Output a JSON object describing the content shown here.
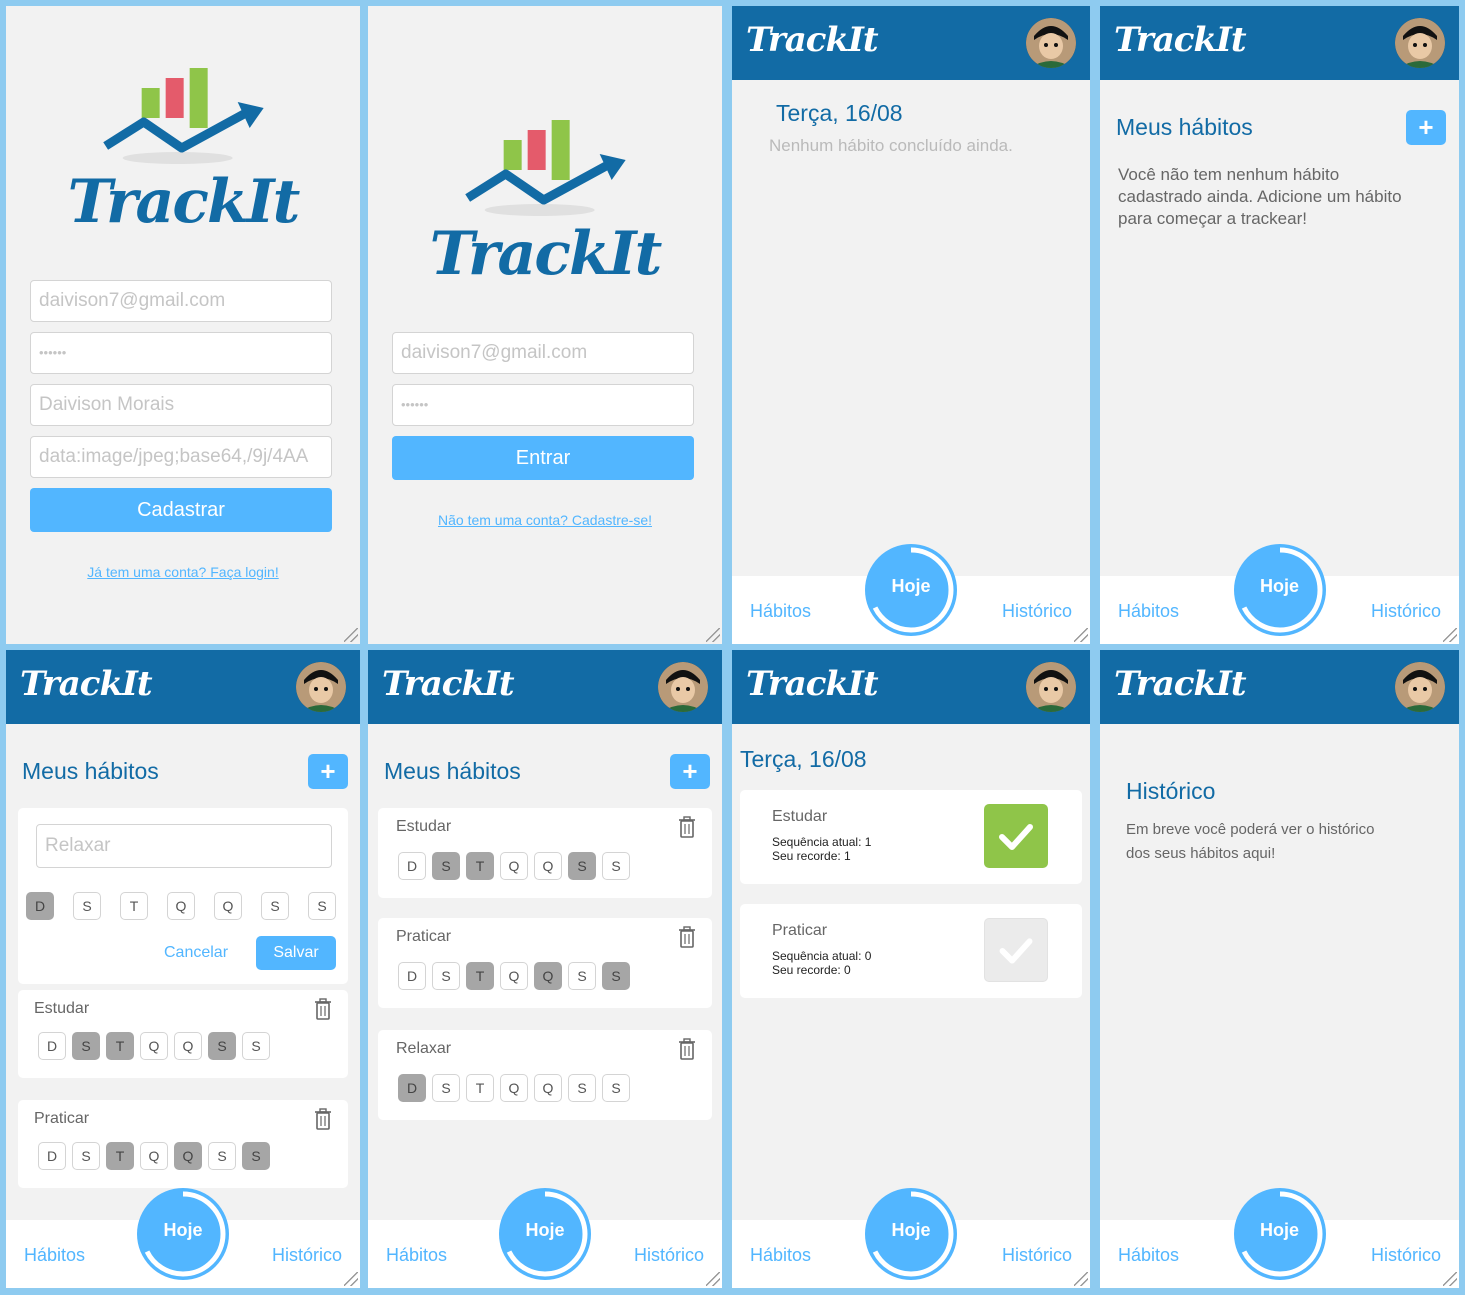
{
  "colors": {
    "primary": "#126ba5",
    "accent": "#52b6ff",
    "checked": "#8fc549",
    "unchecked": "#ebebeb",
    "selected_day": "#a6a6a6"
  },
  "brand": "TrackIt",
  "signup": {
    "email": "daivison7@gmail.com",
    "password": "••••••",
    "name": "Daivison Morais",
    "photo": "data:image/jpeg;base64,/9j/4AA",
    "button": "Cadastrar",
    "link": "Já tem uma conta? Faça login!"
  },
  "login": {
    "email": "daivison7@gmail.com",
    "password": "••••••",
    "button": "Entrar",
    "link": "Não tem uma conta? Cadastre-se!"
  },
  "footer": {
    "habitos": "Hábitos",
    "hoje": "Hoje",
    "historico": "Histórico"
  },
  "today_empty": {
    "date": "Terça, 16/08",
    "subtitle": "Nenhum hábito concluído ainda."
  },
  "habits_empty": {
    "title": "Meus hábitos",
    "plus": "+",
    "message": "Você não tem nenhum hábito cadastrado ainda. Adicione um hábito para começar a trackear!"
  },
  "habits_create": {
    "title": "Meus hábitos",
    "plus": "+",
    "input": "Relaxar",
    "days": [
      "D",
      "S",
      "T",
      "Q",
      "Q",
      "S",
      "S"
    ],
    "cancel": "Cancelar",
    "save": "Salvar",
    "habits": [
      {
        "name": "Estudar"
      },
      {
        "name": "Praticar"
      }
    ]
  },
  "habits_list": {
    "title": "Meus hábitos",
    "plus": "+",
    "habits": [
      {
        "name": "Estudar"
      },
      {
        "name": "Praticar"
      },
      {
        "name": "Relaxar"
      }
    ]
  },
  "today_list": {
    "date": "Terça, 16/08",
    "habits": [
      {
        "name": "Estudar",
        "streak": "Sequência atual: 1",
        "record": "Seu recorde: 1",
        "done": true
      },
      {
        "name": "Praticar",
        "streak": "Sequência atual: 0",
        "record": "Seu recorde: 0",
        "done": false
      }
    ]
  },
  "history": {
    "title": "Histórico",
    "message": "Em breve você poderá ver o histórico dos seus hábitos aqui!"
  },
  "icons": [
    "logo-chart-icon",
    "avatar-icon",
    "trash-icon",
    "check-icon",
    "progress-ring-icon"
  ]
}
